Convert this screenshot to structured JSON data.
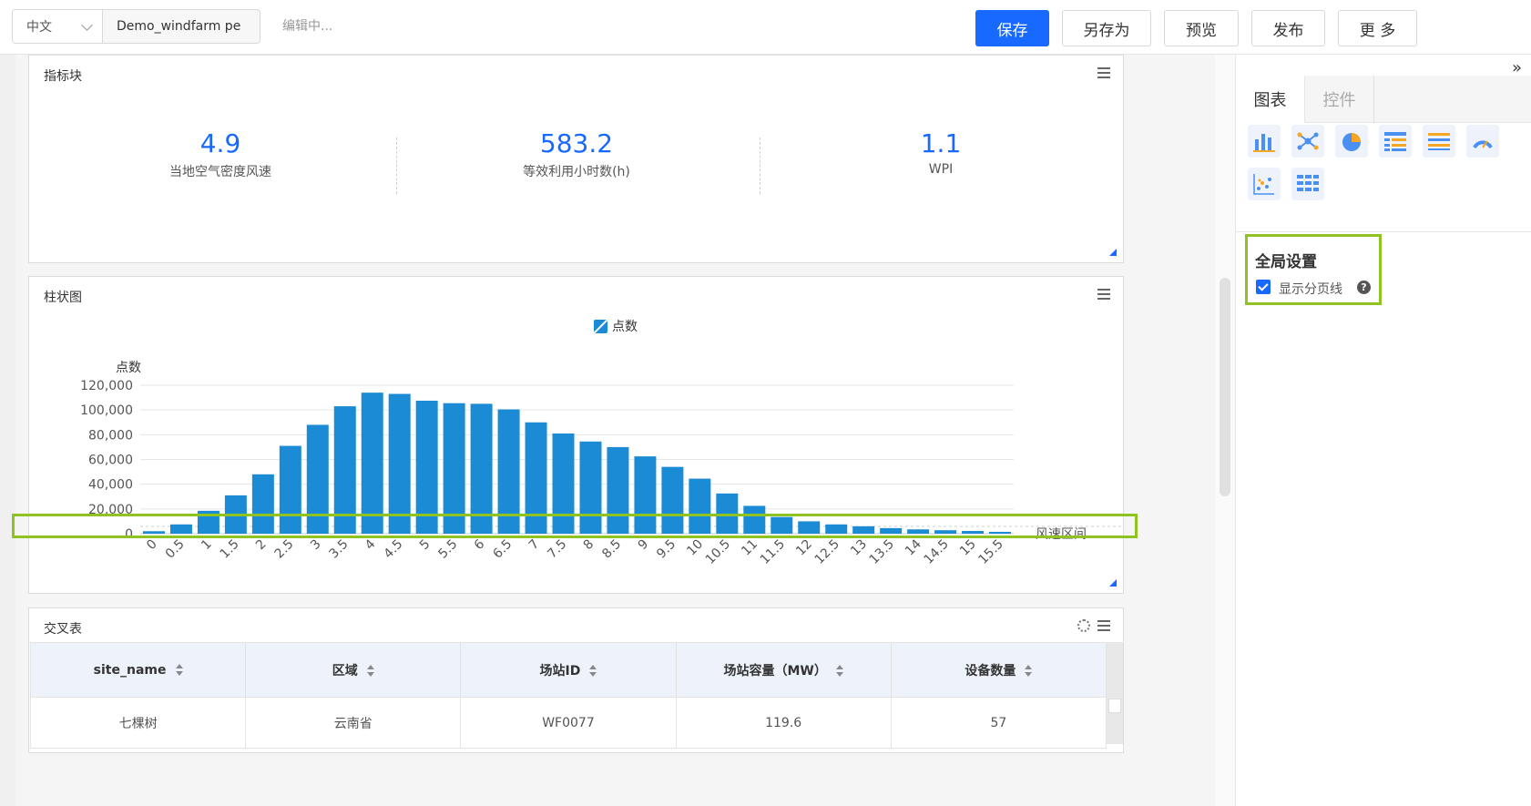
{
  "toolbar": {
    "lang_value": "中文",
    "report_name": "Demo_windfarm pe",
    "edit_status": "编辑中...",
    "buttons": {
      "save": "保存",
      "save_as": "另存为",
      "preview": "预览",
      "publish": "发布",
      "more": "更 多"
    },
    "primary_color": "#1769ff"
  },
  "kpi_card": {
    "title": "指标块",
    "items": [
      {
        "value": "4.9",
        "label": "当地空气密度风速"
      },
      {
        "value": "583.2",
        "label": "等效利用小时数(h)"
      },
      {
        "value": "1.1",
        "label": "WPI"
      }
    ]
  },
  "bar_card": {
    "title": "柱状图",
    "legend": "点数"
  },
  "chart_data": {
    "type": "bar",
    "title": "",
    "xlabel": "风速区间",
    "ylabel": "点数",
    "ylim": [
      0,
      120000
    ],
    "yticks": [
      0,
      20000,
      40000,
      60000,
      80000,
      100000,
      120000
    ],
    "ytick_labels": [
      "0",
      "20,000",
      "40,000",
      "60,000",
      "80,000",
      "100,000",
      "120,000"
    ],
    "categories": [
      "0",
      "0.5",
      "1",
      "1.5",
      "2",
      "2.5",
      "3",
      "3.5",
      "4",
      "4.5",
      "5",
      "5.5",
      "6",
      "6.5",
      "7",
      "7.5",
      "8",
      "8.5",
      "9",
      "9.5",
      "10",
      "10.5",
      "11",
      "11.5",
      "12",
      "12.5",
      "13",
      "13.5",
      "14",
      "14.5",
      "15",
      "15.5"
    ],
    "series": [
      {
        "name": "点数",
        "color": "#1a8bd4",
        "values": [
          2000,
          7500,
          18500,
          31000,
          48000,
          71000,
          88000,
          103000,
          114000,
          113000,
          107500,
          105500,
          105000,
          100500,
          90000,
          81000,
          74500,
          70000,
          62500,
          54000,
          44500,
          32500,
          22500,
          13500,
          10000,
          7500,
          6000,
          4500,
          3500,
          2800,
          2200,
          1500
        ]
      }
    ],
    "grid": true,
    "legend_position": "top-center"
  },
  "cross_table": {
    "title": "交叉表",
    "columns": [
      "site_name",
      "区域",
      "场站ID",
      "场站容量（MW）",
      "设备数量"
    ],
    "rows": [
      [
        "七棵树",
        "云南省",
        "WF0077",
        "119.6",
        "57"
      ]
    ]
  },
  "right_panel": {
    "tabs": [
      "图表",
      "控件"
    ],
    "active_tab": "图表",
    "chart_types": [
      "bar-chart-icon",
      "scatter-network-icon",
      "pie-chart-icon",
      "list-table-icon",
      "striped-table-icon",
      "gauge-icon",
      "scatter-plot-icon",
      "grid-table-icon"
    ],
    "global_settings": {
      "title": "全局设置",
      "show_page_line_label": "显示分页线",
      "show_page_line_checked": true,
      "help": "?"
    },
    "highlight_color": "#8fc31f"
  }
}
